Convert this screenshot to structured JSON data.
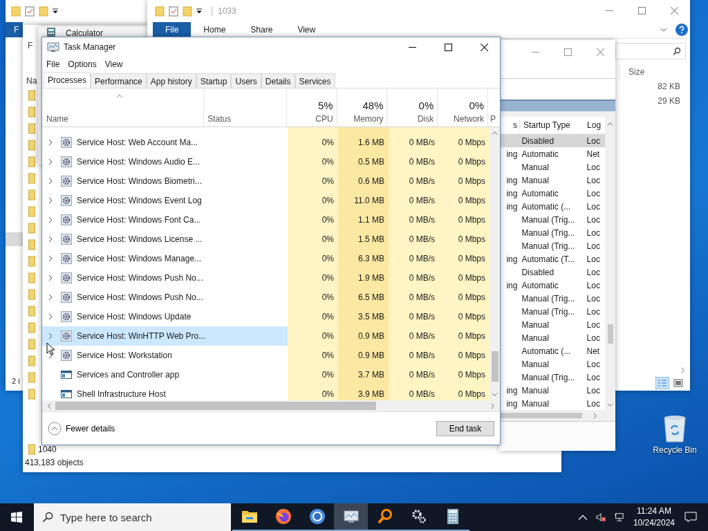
{
  "explorer_back": {
    "ribbon_tab": "F",
    "status": "2 i"
  },
  "explorer_results": {
    "ribbon_tab": "F",
    "column_header": "Na",
    "rows": [
      {
        "name": "1040"
      }
    ],
    "status": "413,183 objects"
  },
  "calculator": {
    "title": "Calculator"
  },
  "explorer_1033": {
    "title": "1033",
    "ribbon_tabs": [
      {
        "label": "File",
        "selected": true
      },
      {
        "label": "Home",
        "selected": false
      },
      {
        "label": "Share",
        "selected": false
      },
      {
        "label": "View",
        "selected": false
      }
    ],
    "column_header": "Size",
    "rows": [
      {
        "size": "82 KB"
      },
      {
        "size": "29 KB"
      }
    ]
  },
  "services": {
    "columns": [
      "s",
      "Startup Type",
      "Log"
    ],
    "rows": [
      {
        "status": "",
        "startup_type": "Disabled",
        "log_on": "Loc",
        "selected": true
      },
      {
        "status": "ing",
        "startup_type": "Automatic",
        "log_on": "Net",
        "selected": false
      },
      {
        "status": "",
        "startup_type": "Manual",
        "log_on": "Loc",
        "selected": false
      },
      {
        "status": "ing",
        "startup_type": "Manual",
        "log_on": "Loc",
        "selected": false
      },
      {
        "status": "ing",
        "startup_type": "Automatic",
        "log_on": "Loc",
        "selected": false
      },
      {
        "status": "ing",
        "startup_type": "Automatic (...",
        "log_on": "Loc",
        "selected": false
      },
      {
        "status": "",
        "startup_type": "Manual (Trig...",
        "log_on": "Loc",
        "selected": false
      },
      {
        "status": "",
        "startup_type": "Manual (Trig...",
        "log_on": "Loc",
        "selected": false
      },
      {
        "status": "",
        "startup_type": "Manual (Trig...",
        "log_on": "Loc",
        "selected": false
      },
      {
        "status": "ing",
        "startup_type": "Automatic (T...",
        "log_on": "Loc",
        "selected": false
      },
      {
        "status": "",
        "startup_type": "Disabled",
        "log_on": "Loc",
        "selected": false
      },
      {
        "status": "ing",
        "startup_type": "Automatic",
        "log_on": "Loc",
        "selected": false
      },
      {
        "status": "",
        "startup_type": "Manual (Trig...",
        "log_on": "Loc",
        "selected": false
      },
      {
        "status": "",
        "startup_type": "Manual (Trig...",
        "log_on": "Loc",
        "selected": false
      },
      {
        "status": "",
        "startup_type": "Manual",
        "log_on": "Loc",
        "selected": false
      },
      {
        "status": "",
        "startup_type": "Manual",
        "log_on": "Loc",
        "selected": false
      },
      {
        "status": "",
        "startup_type": "Automatic (...",
        "log_on": "Net",
        "selected": false
      },
      {
        "status": "",
        "startup_type": "Manual",
        "log_on": "Loc",
        "selected": false
      },
      {
        "status": "",
        "startup_type": "Manual (Trig...",
        "log_on": "Loc",
        "selected": false
      },
      {
        "status": "ing",
        "startup_type": "Manual",
        "log_on": "Loc",
        "selected": false
      },
      {
        "status": "ing",
        "startup_type": "Manual",
        "log_on": "Loc",
        "selected": false
      }
    ]
  },
  "task_manager": {
    "title": "Task Manager",
    "menu": [
      "File",
      "Options",
      "View"
    ],
    "tabs": [
      {
        "label": "Processes",
        "selected": true
      },
      {
        "label": "Performance",
        "selected": false
      },
      {
        "label": "App history",
        "selected": false
      },
      {
        "label": "Startup",
        "selected": false
      },
      {
        "label": "Users",
        "selected": false
      },
      {
        "label": "Details",
        "selected": false
      },
      {
        "label": "Services",
        "selected": false
      }
    ],
    "columns": [
      {
        "kind": "name",
        "label": "Name"
      },
      {
        "kind": "status",
        "label": "Status"
      },
      {
        "kind": "metric",
        "total": "5%",
        "label": "CPU"
      },
      {
        "kind": "metric",
        "total": "48%",
        "label": "Memory"
      },
      {
        "kind": "metric",
        "total": "0%",
        "label": "Disk"
      },
      {
        "kind": "metric",
        "total": "0%",
        "label": "Network"
      },
      {
        "kind": "cut",
        "label": "P"
      }
    ],
    "rows": [
      {
        "kind": "service",
        "name": "Service Host: Web Account Ma...",
        "cpu": "0%",
        "memory": "1.6 MB",
        "disk": "0 MB/s",
        "network": "0 Mbps",
        "selected": false
      },
      {
        "kind": "service",
        "name": "Service Host: Windows Audio E...",
        "cpu": "0%",
        "memory": "0.5 MB",
        "disk": "0 MB/s",
        "network": "0 Mbps",
        "selected": false
      },
      {
        "kind": "service",
        "name": "Service Host: Windows Biometri...",
        "cpu": "0%",
        "memory": "0.6 MB",
        "disk": "0 MB/s",
        "network": "0 Mbps",
        "selected": false
      },
      {
        "kind": "service",
        "name": "Service Host: Windows Event Log",
        "cpu": "0%",
        "memory": "11.0 MB",
        "disk": "0 MB/s",
        "network": "0 Mbps",
        "selected": false
      },
      {
        "kind": "service",
        "name": "Service Host: Windows Font Ca...",
        "cpu": "0%",
        "memory": "1.1 MB",
        "disk": "0 MB/s",
        "network": "0 Mbps",
        "selected": false
      },
      {
        "kind": "service",
        "name": "Service Host: Windows License ...",
        "cpu": "0%",
        "memory": "1.5 MB",
        "disk": "0 MB/s",
        "network": "0 Mbps",
        "selected": false
      },
      {
        "kind": "service",
        "name": "Service Host: Windows Manage...",
        "cpu": "0%",
        "memory": "6.3 MB",
        "disk": "0 MB/s",
        "network": "0 Mbps",
        "selected": false
      },
      {
        "kind": "service",
        "name": "Service Host: Windows Push No...",
        "cpu": "0%",
        "memory": "1.9 MB",
        "disk": "0 MB/s",
        "network": "0 Mbps",
        "selected": false
      },
      {
        "kind": "service",
        "name": "Service Host: Windows Push No...",
        "cpu": "0%",
        "memory": "6.5 MB",
        "disk": "0 MB/s",
        "network": "0 Mbps",
        "selected": false
      },
      {
        "kind": "service",
        "name": "Service Host: Windows Update",
        "cpu": "0%",
        "memory": "3.5 MB",
        "disk": "0 MB/s",
        "network": "0 Mbps",
        "selected": false
      },
      {
        "kind": "service",
        "name": "Service Host: WinHTTP Web Pro...",
        "cpu": "0%",
        "memory": "0.9 MB",
        "disk": "0 MB/s",
        "network": "0 Mbps",
        "selected": true
      },
      {
        "kind": "service",
        "name": "Service Host: Workstation",
        "cpu": "0%",
        "memory": "0.9 MB",
        "disk": "0 MB/s",
        "network": "0 Mbps",
        "selected": false
      },
      {
        "kind": "app",
        "name": "Services and Controller app",
        "cpu": "0%",
        "memory": "3.7 MB",
        "disk": "0 MB/s",
        "network": "0 Mbps",
        "selected": false
      },
      {
        "kind": "app",
        "name": "Shell Infrastructure Host",
        "cpu": "0%",
        "memory": "3.9 MB",
        "disk": "0 MB/s",
        "network": "0 Mbps",
        "selected": false
      }
    ],
    "details_toggle": "Fewer details",
    "end_button": "End task"
  },
  "desktop": {
    "icons": [
      {
        "label": "Recycle Bin"
      }
    ]
  },
  "taskbar": {
    "search_placeholder": "Type here to search",
    "apps": [
      {
        "kind": "folder",
        "active": false
      },
      {
        "kind": "firefox",
        "active": false
      },
      {
        "kind": "chrome",
        "active": false
      },
      {
        "kind": "taskmgr",
        "active": true
      },
      {
        "kind": "magnifier",
        "active": false
      },
      {
        "kind": "gear",
        "active": false
      },
      {
        "kind": "calculator",
        "active": false
      }
    ],
    "time": "11:24 AM",
    "date": "10/24/2024"
  }
}
